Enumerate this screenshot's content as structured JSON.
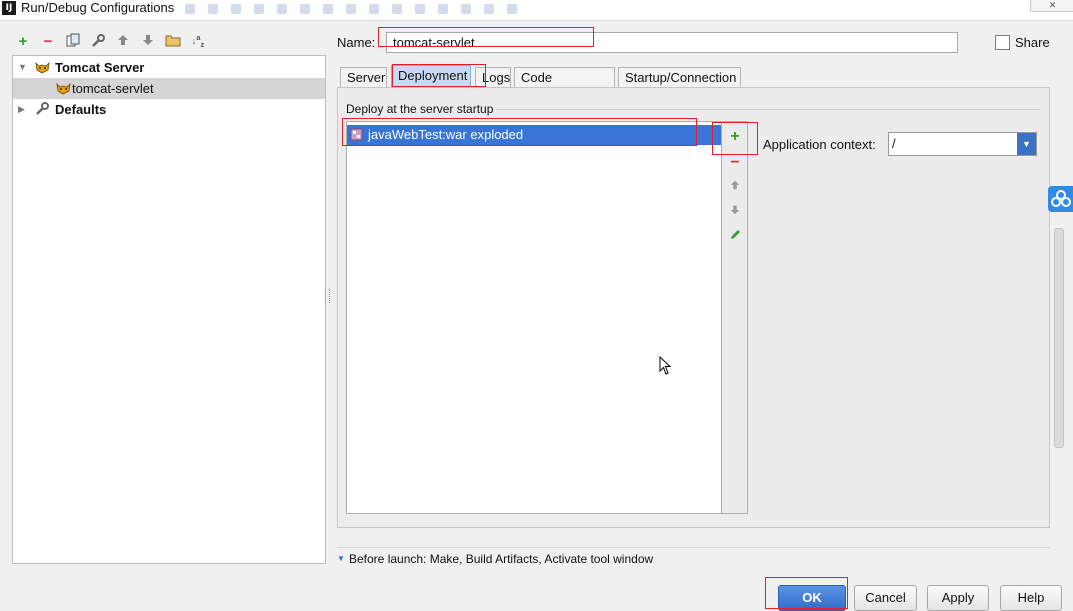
{
  "window": {
    "title": "Run/Debug Configurations",
    "app_icon": "IJ"
  },
  "toolbar": {
    "icons": [
      "add-icon",
      "remove-icon",
      "copy-icon",
      "settings-icon",
      "move-up-icon",
      "move-down-icon",
      "folder-icon",
      "sort-icon"
    ]
  },
  "tree": {
    "group": "Tomcat Server",
    "child": "tomcat-servlet",
    "defaults": "Defaults"
  },
  "form": {
    "name_label": "Name:",
    "name_value": "tomcat-servlet",
    "share_label": "Share"
  },
  "tabs": [
    "Server",
    "Deployment",
    "Logs",
    "Code Coverage",
    "Startup/Connection"
  ],
  "deployment": {
    "section_label": "Deploy at the server startup",
    "items": [
      "javaWebTest:war exploded"
    ],
    "context_label": "Application context:",
    "context_value": "/"
  },
  "before_launch": "Before launch: Make, Build Artifacts, Activate tool window",
  "buttons": {
    "ok": "OK",
    "cancel": "Cancel",
    "apply": "Apply",
    "help": "Help"
  },
  "colors": {
    "selection": "#3875d7",
    "active_tab": "#c9daf0",
    "add_green": "#2e9e2e",
    "remove_red": "#d83b3b",
    "annotation_red": "#e0202a"
  }
}
